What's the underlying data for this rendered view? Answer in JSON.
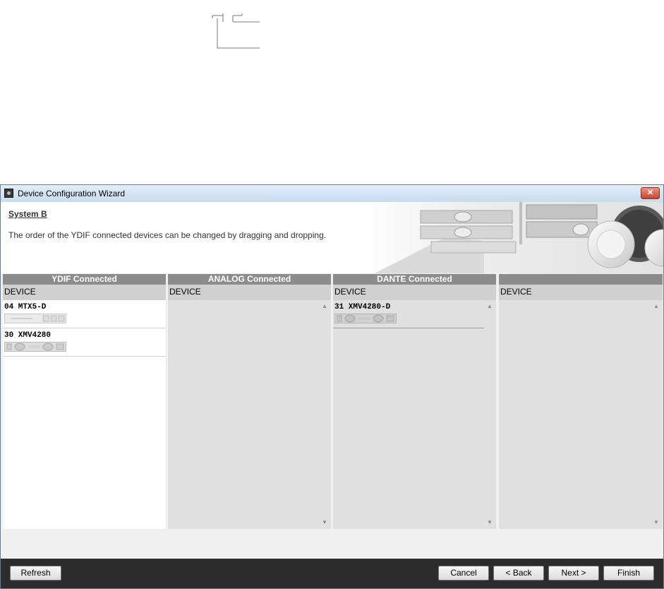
{
  "window": {
    "title": "Device Configuration Wizard",
    "close_label": "✕"
  },
  "header": {
    "title": "System B",
    "description": "The order of the YDIF connected devices can be changed by dragging and dropping."
  },
  "columns": [
    {
      "header": "YDIF Connected",
      "subheader": "DEVICE",
      "devices": [
        {
          "label": "04 MTX5-D"
        },
        {
          "label": "30 XMV4280"
        }
      ]
    },
    {
      "header": "ANALOG Connected",
      "subheader": "DEVICE",
      "devices": []
    },
    {
      "header": "DANTE Connected",
      "subheader": "DEVICE",
      "devices": [
        {
          "label": "31 XMV4280-D"
        }
      ]
    },
    {
      "header": "",
      "subheader": "DEVICE",
      "devices": []
    }
  ],
  "scrollbar": {
    "up_glyph": "▲",
    "down_glyph": "▼"
  },
  "footer": {
    "refresh_label": "Refresh",
    "cancel_label": "Cancel",
    "back_label": "< Back",
    "next_label": "Next >",
    "finish_label": "Finish"
  },
  "colors": {
    "column_header": "#8c8c8c",
    "column_subheader": "#d0d0d0",
    "footer": "#2c2c2c",
    "close_button": "#c7472e"
  }
}
